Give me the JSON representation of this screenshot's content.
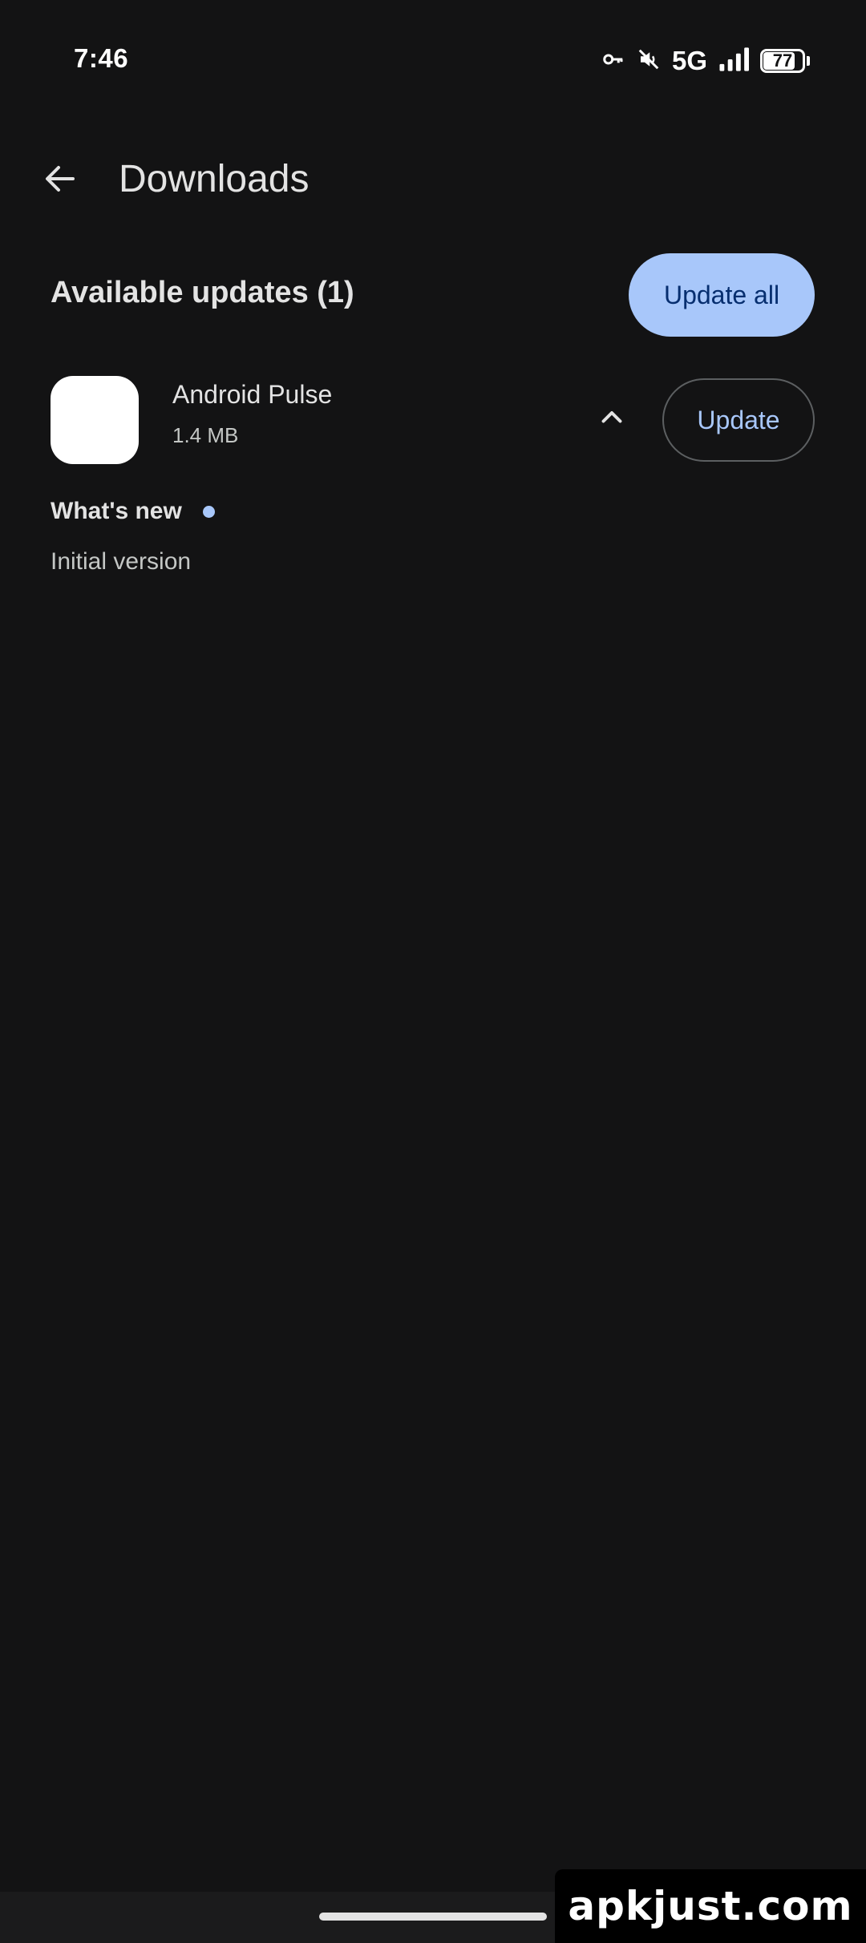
{
  "status_bar": {
    "time": "7:46",
    "network": "5G",
    "battery_level": "77",
    "icons": [
      "vpn-key-icon",
      "mute-icon",
      "signal-icon",
      "battery-icon"
    ]
  },
  "app_bar": {
    "title": "Downloads",
    "back_icon": "arrow-back-icon"
  },
  "updates_section": {
    "title": "Available updates (1)",
    "update_all_label": "Update all"
  },
  "apps": [
    {
      "name": "Android Pulse",
      "size": "1.4 MB",
      "update_label": "Update",
      "expand_icon": "chevron-up-icon",
      "whats_new_label": "What's new",
      "whats_new_text": "Initial version"
    }
  ],
  "watermark": "apkjust.com",
  "colors": {
    "background": "#131314",
    "accent": "#a8c7fa",
    "on_accent": "#062e6f",
    "text_primary": "#e3e3e3",
    "text_secondary": "#c4c7c5"
  }
}
